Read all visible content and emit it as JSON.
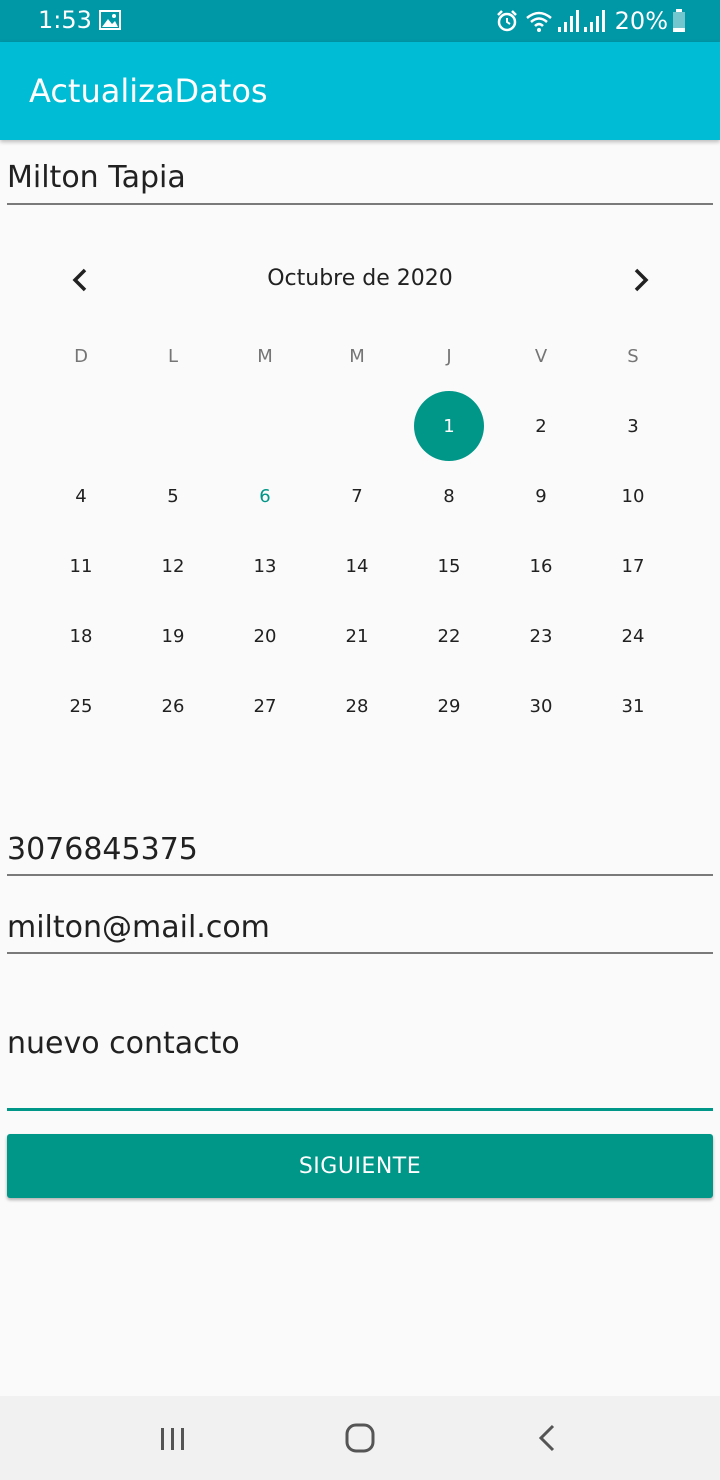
{
  "status_bar": {
    "time": "1:53",
    "battery": "20%",
    "icons": [
      "gallery-icon",
      "alarm-icon",
      "wifi-icon",
      "signal-icon",
      "signal-icon",
      "battery-icon"
    ]
  },
  "app_bar": {
    "title": "ActualizaDatos"
  },
  "form": {
    "name": "Milton Tapia",
    "phone": "3076845375",
    "email": "milton@mail.com",
    "note": "nuevo contacto"
  },
  "calendar": {
    "title": "Octubre de 2020",
    "weekdays": [
      "D",
      "L",
      "M",
      "M",
      "J",
      "V",
      "S"
    ],
    "leading_blanks": 4,
    "days": [
      "1",
      "2",
      "3",
      "4",
      "5",
      "6",
      "7",
      "8",
      "9",
      "10",
      "11",
      "12",
      "13",
      "14",
      "15",
      "16",
      "17",
      "18",
      "19",
      "20",
      "21",
      "22",
      "23",
      "24",
      "25",
      "26",
      "27",
      "28",
      "29",
      "30",
      "31"
    ],
    "selected_day": "1",
    "today": "6"
  },
  "button": {
    "label": "SIGUIENTE"
  },
  "colors": {
    "status_bar": "#0097A7",
    "app_bar": "#00BCD4",
    "accent": "#009688"
  }
}
